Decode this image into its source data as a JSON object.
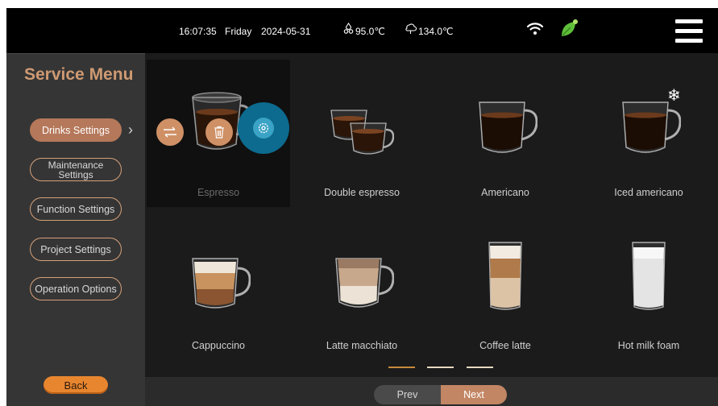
{
  "status_bar": {
    "time": "16:07:35",
    "day": "Friday",
    "date": "2024-05-31",
    "water_temp": "95.0℃",
    "steam_temp": "134.0℃",
    "icons": [
      "water-temp-icon",
      "steam-temp-icon",
      "wifi-icon",
      "leaf-icon",
      "hamburger-menu-icon"
    ]
  },
  "sidebar": {
    "title": "Service Menu",
    "items": [
      {
        "label": "Drinks Settings",
        "active": true
      },
      {
        "label": "Maintenance Settings",
        "active": false
      },
      {
        "label": "Function Settings",
        "active": false
      },
      {
        "label": "Project Settings",
        "active": false
      },
      {
        "label": "Operation Options",
        "active": false
      }
    ],
    "back_label": "Back"
  },
  "drinks": [
    {
      "name": "Espresso",
      "selected": true
    },
    {
      "name": "Double espresso",
      "selected": false
    },
    {
      "name": "Americano",
      "selected": false
    },
    {
      "name": "Iced americano",
      "selected": false,
      "badge": "snowflake-icon"
    },
    {
      "name": "Cappuccino",
      "selected": false
    },
    {
      "name": "Latte macchiato",
      "selected": false
    },
    {
      "name": "Coffee latte",
      "selected": false
    },
    {
      "name": "Hot milk foam",
      "selected": false
    }
  ],
  "tile_actions": [
    "swap-icon",
    "trash-icon",
    "settings-icon"
  ],
  "pagination": {
    "pages": 3,
    "current_page": 1,
    "prev_label": "Prev",
    "next_label": "Next"
  },
  "colors": {
    "accent": "#cf9a72",
    "active_pill": "#b5785a",
    "back_button": "#e8862f",
    "settings_action": "#0c6b8f",
    "leaf": "#5fbf3a",
    "page_active": "#c98a3a",
    "page_inactive": "#e6d8c0"
  }
}
